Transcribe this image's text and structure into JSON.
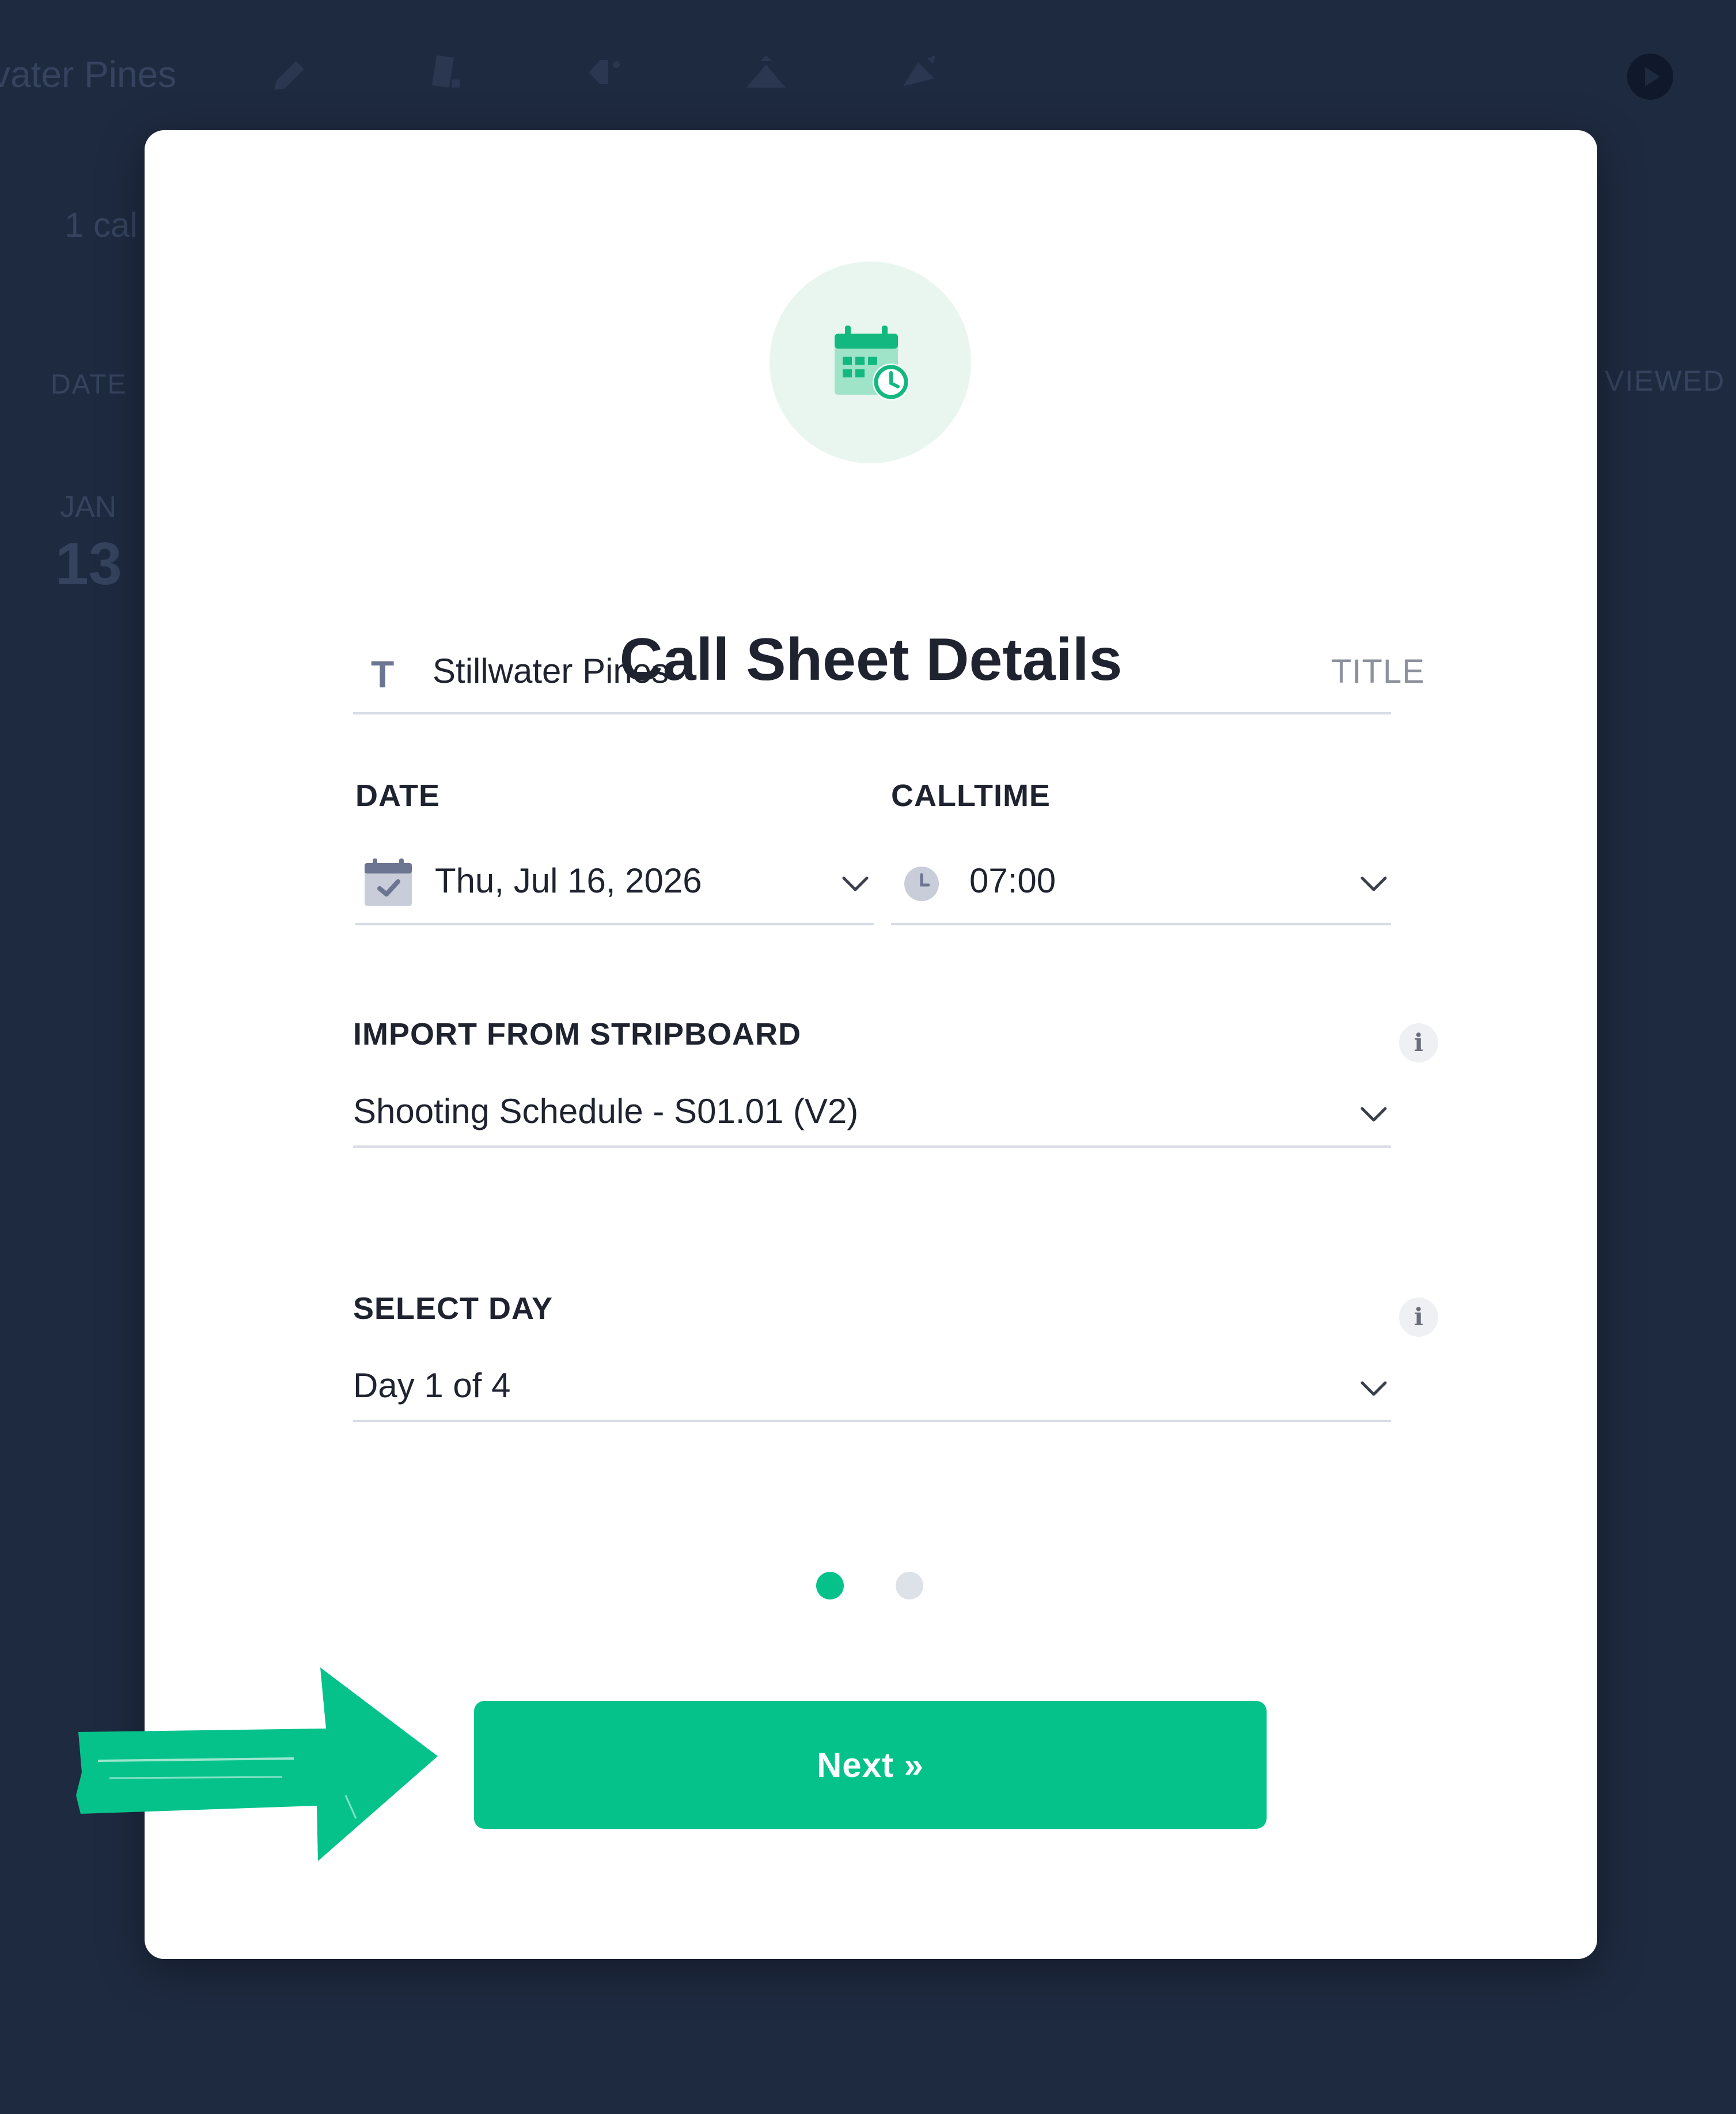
{
  "background": {
    "project_title": "vater Pines",
    "subtitle": "1 cal",
    "columns": {
      "date": "DATE",
      "viewed": "VIEWED"
    },
    "row": {
      "month": "JAN",
      "day": "13"
    },
    "toolbar_icons": [
      "pencil-icon",
      "note-icon",
      "tag-icon",
      "mountain-icon",
      "edit-icon"
    ],
    "play_icon": "play-icon"
  },
  "modal": {
    "icon": "calendar-clock-icon",
    "title": "Call Sheet Details",
    "title_field": {
      "icon": "T",
      "value": "Stillwater Pines",
      "hint": "TITLE"
    },
    "date_field": {
      "label": "DATE",
      "value": "Thu, Jul 16, 2026"
    },
    "calltime_field": {
      "label": "CALLTIME",
      "value": "07:00"
    },
    "stripboard_field": {
      "label": "IMPORT FROM STRIPBOARD",
      "value": "Shooting Schedule - S01.01 (V2)",
      "info": "i"
    },
    "day_field": {
      "label": "SELECT DAY",
      "value": "Day 1 of 4",
      "info": "i"
    },
    "pagination": {
      "current": 1,
      "total": 2
    },
    "next_button": "Next »"
  },
  "colors": {
    "accent": "#05c28b",
    "backdrop": "#1e2a40",
    "dot_inactive": "#dde1e8"
  }
}
